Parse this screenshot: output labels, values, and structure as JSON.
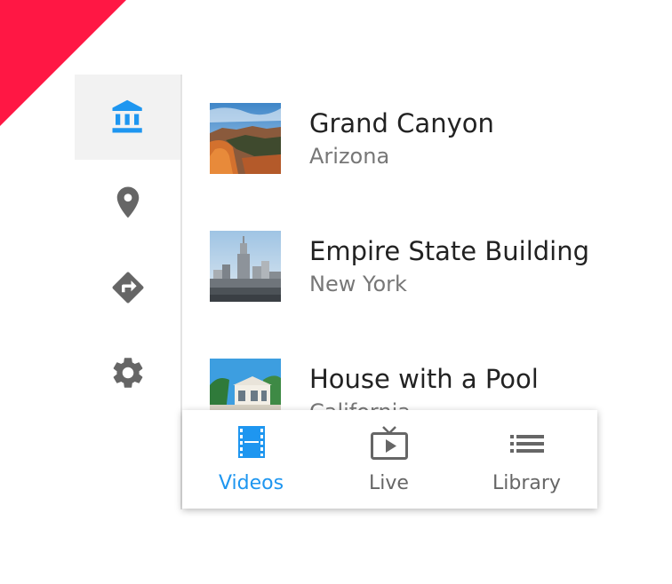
{
  "colors": {
    "accent": "#1e96f0",
    "ribbon": "#ff1744",
    "icon_inactive": "#666666",
    "title_text": "#222222",
    "subtitle_text": "#777777"
  },
  "sidebar": {
    "items": [
      {
        "icon": "museum-icon",
        "active": true
      },
      {
        "icon": "place-icon",
        "active": false
      },
      {
        "icon": "directions-icon",
        "active": false
      },
      {
        "icon": "gear-icon",
        "active": false
      }
    ]
  },
  "list": {
    "items": [
      {
        "title": "Grand Canyon",
        "subtitle": "Arizona",
        "image": "canyon-photo"
      },
      {
        "title": "Empire State Building",
        "subtitle": "New York",
        "image": "skyline-photo"
      },
      {
        "title": "House with a Pool",
        "subtitle": "California",
        "image": "pool-house-photo"
      }
    ]
  },
  "bottom_nav": {
    "items": [
      {
        "label": "Videos",
        "icon": "movie-icon",
        "active": true
      },
      {
        "label": "Live",
        "icon": "live-tv-icon",
        "active": false
      },
      {
        "label": "Library",
        "icon": "list-icon",
        "active": false
      }
    ]
  }
}
